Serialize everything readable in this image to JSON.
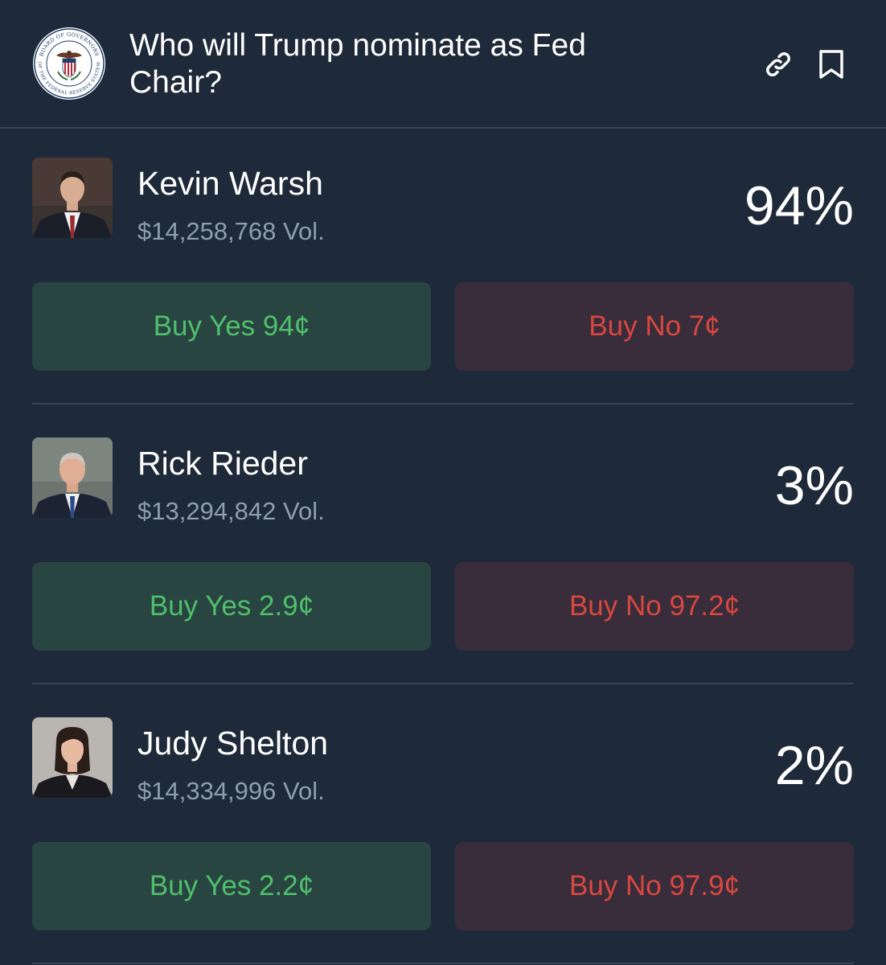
{
  "header": {
    "title": "Who will Trump nominate as Fed Chair?",
    "seal_text_top": "BOARD OF GOVERNORS",
    "seal_text_bottom": "OF THE FEDERAL RESERVE SYSTEM",
    "icons": [
      "link-icon",
      "bookmark-icon"
    ]
  },
  "outcomes": [
    {
      "name": "Kevin Warsh",
      "volume": "$14,258,768 Vol.",
      "percent": "94%",
      "buy_yes": "Buy Yes 94¢",
      "buy_no": "Buy No 7¢"
    },
    {
      "name": "Rick Rieder",
      "volume": "$13,294,842 Vol.",
      "percent": "3%",
      "buy_yes": "Buy Yes 2.9¢",
      "buy_no": "Buy No 97.2¢"
    },
    {
      "name": "Judy Shelton",
      "volume": "$14,334,996 Vol.",
      "percent": "2%",
      "buy_yes": "Buy Yes 2.2¢",
      "buy_no": "Buy No 97.9¢"
    }
  ],
  "colors": {
    "background": "#1e2a3a",
    "divider": "#364456",
    "yes_bg": "#294541",
    "yes_text": "#4fbf6c",
    "no_bg": "#392c3b",
    "no_text": "#d8483f",
    "muted_text": "#8e9db0"
  }
}
